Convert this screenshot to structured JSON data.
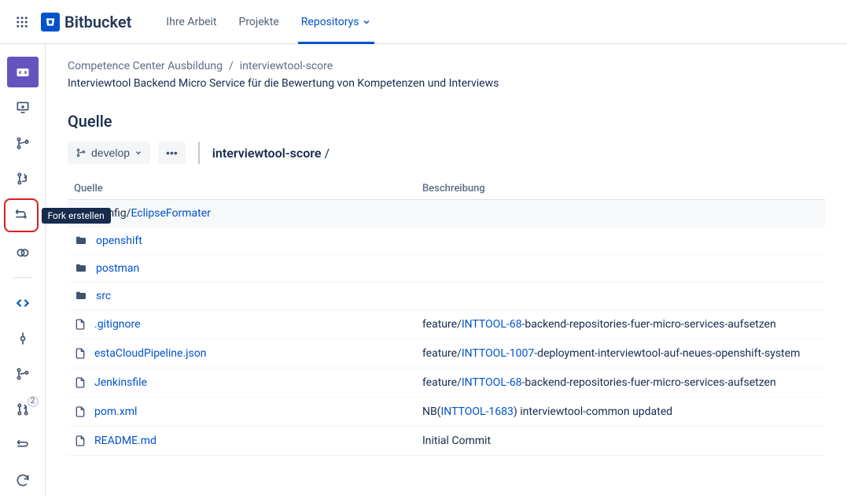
{
  "brand": "Bitbucket",
  "topnav": {
    "items": [
      {
        "label": "Ihre Arbeit"
      },
      {
        "label": "Projekte"
      },
      {
        "label": "Repositorys",
        "active": true,
        "dropdown": true
      }
    ]
  },
  "sidebar": {
    "tooltip_fork": "Fork erstellen",
    "badge_pr_count": "2"
  },
  "breadcrumb": {
    "project": "Competence Center Ausbildung",
    "repo": "interviewtool-score"
  },
  "description": "Interviewtool Backend Micro Service für die Bewertung von Kompetenzen und Interviews",
  "section_title": "Quelle",
  "branch_selector": {
    "label": "develop"
  },
  "more_label": "•••",
  "path": {
    "repo": "interviewtool-score",
    "sep": "/"
  },
  "table": {
    "columns": {
      "source": "Quelle",
      "description": "Beschreibung"
    },
    "rows": [
      {
        "type": "dir",
        "segments": [
          {
            "text": "config/",
            "link": false
          },
          {
            "text": "EclipseFormater",
            "link": true
          }
        ],
        "desc_prefix": "",
        "issue": "",
        "desc_suffix": "",
        "hover": true
      },
      {
        "type": "dir",
        "segments": [
          {
            "text": "openshift",
            "link": true
          }
        ],
        "desc_prefix": "",
        "issue": "",
        "desc_suffix": ""
      },
      {
        "type": "dir",
        "segments": [
          {
            "text": "postman",
            "link": true
          }
        ],
        "desc_prefix": "",
        "issue": "",
        "desc_suffix": ""
      },
      {
        "type": "dir",
        "segments": [
          {
            "text": "src",
            "link": true
          }
        ],
        "desc_prefix": "",
        "issue": "",
        "desc_suffix": ""
      },
      {
        "type": "file",
        "segments": [
          {
            "text": ".gitignore",
            "link": true
          }
        ],
        "desc_prefix": "feature/",
        "issue": "INTTOOL-68",
        "desc_suffix": "-backend-repositories-fuer-micro-services-aufsetzen"
      },
      {
        "type": "file",
        "segments": [
          {
            "text": "estaCloudPipeline.json",
            "link": true
          }
        ],
        "desc_prefix": "feature/",
        "issue": "INTTOOL-1007",
        "desc_suffix": "-deployment-interviewtool-auf-neues-openshift-system"
      },
      {
        "type": "file",
        "segments": [
          {
            "text": "Jenkinsfile",
            "link": true
          }
        ],
        "desc_prefix": "feature/",
        "issue": "INTTOOL-68",
        "desc_suffix": "-backend-repositories-fuer-micro-services-aufsetzen"
      },
      {
        "type": "file",
        "segments": [
          {
            "text": "pom.xml",
            "link": true
          }
        ],
        "desc_prefix": "NB(",
        "issue": "INTTOOL-1683",
        "desc_suffix": ") interviewtool-common updated"
      },
      {
        "type": "file",
        "segments": [
          {
            "text": "README.md",
            "link": true
          }
        ],
        "desc_prefix": "Initial Commit",
        "issue": "",
        "desc_suffix": ""
      }
    ]
  }
}
